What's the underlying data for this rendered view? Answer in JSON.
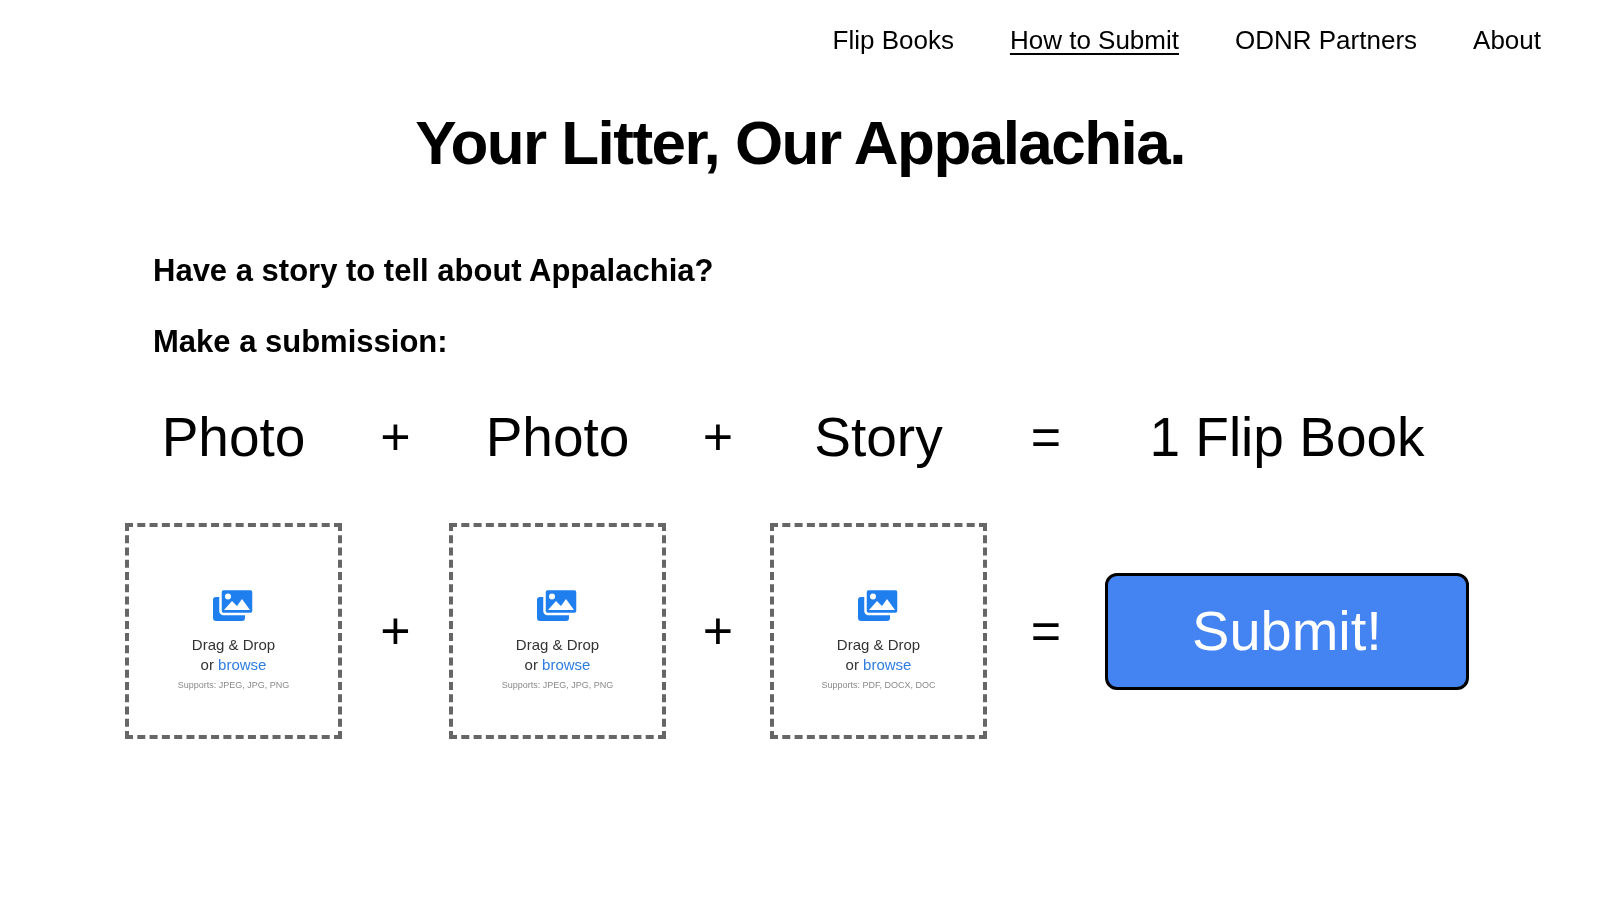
{
  "nav": [
    {
      "label": "Flip Books",
      "selected": false
    },
    {
      "label": "How to Submit",
      "selected": true
    },
    {
      "label": "ODNR Partners",
      "selected": false
    },
    {
      "label": "About",
      "selected": false
    }
  ],
  "title": "Your Litter, Our Appalachia.",
  "intro": [
    "Have a story to tell about Appalachia?",
    "Make a submission:"
  ],
  "equation": [
    {
      "kind": "term",
      "label": "Photo"
    },
    {
      "kind": "operator",
      "label": "+"
    },
    {
      "kind": "term",
      "label": "Photo"
    },
    {
      "kind": "operator",
      "label": "+"
    },
    {
      "kind": "term",
      "label": "Story"
    },
    {
      "kind": "operator",
      "label": "="
    },
    {
      "kind": "term",
      "label": "1 Flip Book"
    }
  ],
  "uploads": [
    {
      "kind": "dropzone",
      "prompt": "Drag & Drop",
      "browse_prefix": "or",
      "browse_link": "browse",
      "supports": "Supports: JPEG, JPG, PNG"
    },
    {
      "kind": "operator",
      "label": "+"
    },
    {
      "kind": "dropzone",
      "prompt": "Drag & Drop",
      "browse_prefix": "or",
      "browse_link": "browse",
      "supports": "Supports: JPEG, JPG, PNG"
    },
    {
      "kind": "operator",
      "label": "+"
    },
    {
      "kind": "dropzone",
      "prompt": "Drag & Drop",
      "browse_prefix": "or",
      "browse_link": "browse",
      "supports": "Supports: PDF, DOCX, DOC"
    },
    {
      "kind": "operator",
      "label": "="
    },
    {
      "kind": "button",
      "label": "Submit!"
    }
  ]
}
